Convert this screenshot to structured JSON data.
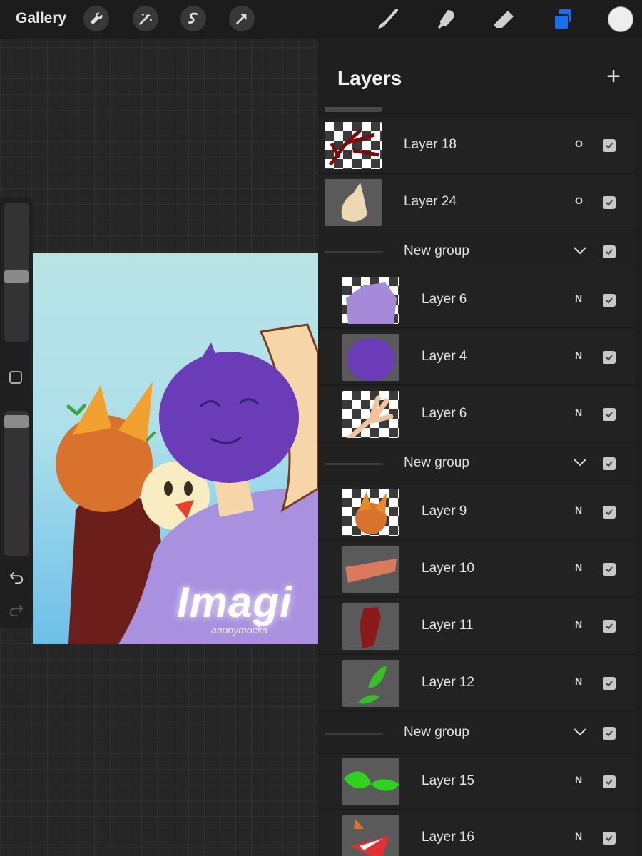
{
  "toolbar": {
    "gallery_label": "Gallery",
    "left_tools": [
      "wrench-icon",
      "magic-wand-icon",
      "selection-icon",
      "transform-arrow-icon"
    ],
    "right_tools": [
      "brush-icon",
      "smudge-icon",
      "eraser-icon",
      "layers-icon"
    ],
    "accent_color": "#1a6ee8",
    "current_color": "#eeeeee"
  },
  "canvas": {
    "title_text": "Imagi",
    "signature_text": "anonymocka"
  },
  "layers_panel": {
    "title": "Layers",
    "add_icon": "+",
    "rows": [
      {
        "type": "layer",
        "name": "Layer 18",
        "blend": "O",
        "visible": true,
        "thumb": "branches"
      },
      {
        "type": "layer",
        "name": "Layer 24",
        "blend": "O",
        "visible": true,
        "thumb": "hand-beige"
      },
      {
        "type": "group",
        "name": "New group",
        "visible": true
      },
      {
        "type": "layer",
        "name": "Layer 6",
        "blend": "N",
        "visible": true,
        "thumb": "shirt-purple"
      },
      {
        "type": "layer",
        "name": "Layer 4",
        "blend": "N",
        "visible": true,
        "thumb": "head-purple"
      },
      {
        "type": "layer",
        "name": "Layer 6",
        "blend": "N",
        "visible": true,
        "thumb": "hand-peace"
      },
      {
        "type": "group",
        "name": "New group",
        "visible": true
      },
      {
        "type": "layer",
        "name": "Layer 9",
        "blend": "N",
        "visible": true,
        "thumb": "head-orange"
      },
      {
        "type": "layer",
        "name": "Layer 10",
        "blend": "N",
        "visible": true,
        "thumb": "stroke-orange"
      },
      {
        "type": "layer",
        "name": "Layer 11",
        "blend": "N",
        "visible": true,
        "thumb": "body-darkred"
      },
      {
        "type": "layer",
        "name": "Layer 12",
        "blend": "N",
        "visible": true,
        "thumb": "leaves-green"
      },
      {
        "type": "group",
        "name": "New group",
        "visible": true
      },
      {
        "type": "layer",
        "name": "Layer 15",
        "blend": "N",
        "visible": true,
        "thumb": "leaves-bright-green"
      },
      {
        "type": "layer",
        "name": "Layer 16",
        "blend": "N",
        "visible": true,
        "thumb": "shapes-red"
      }
    ]
  }
}
